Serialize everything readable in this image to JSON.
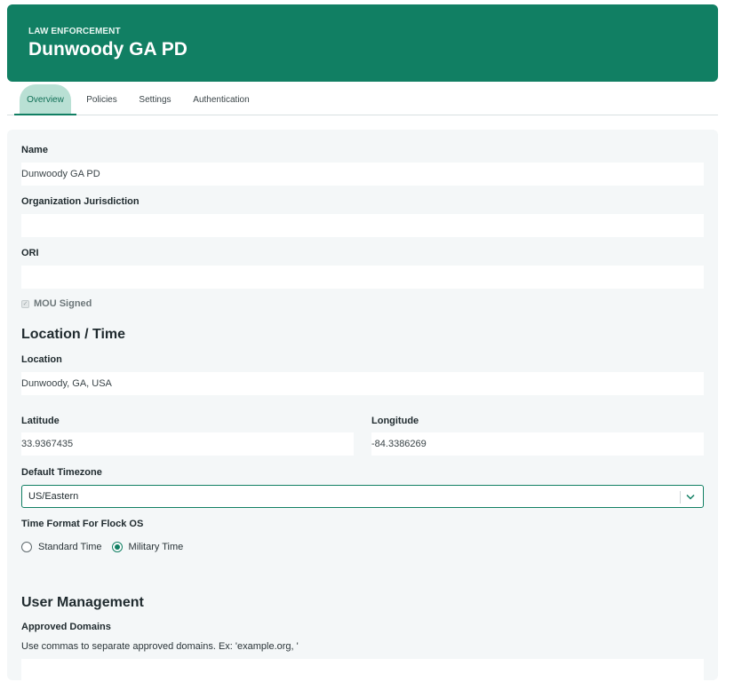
{
  "header": {
    "eyebrow": "LAW ENFORCEMENT",
    "title": "Dunwoody GA PD"
  },
  "tabs": [
    {
      "label": "Overview",
      "active": true
    },
    {
      "label": "Policies",
      "active": false
    },
    {
      "label": "Settings",
      "active": false
    },
    {
      "label": "Authentication",
      "active": false
    }
  ],
  "form": {
    "name_label": "Name",
    "name_value": "Dunwoody GA PD",
    "jurisdiction_label": "Organization Jurisdiction",
    "jurisdiction_value": "",
    "ori_label": "ORI",
    "ori_value": "",
    "mou_label": "MOU Signed",
    "mou_checked": true
  },
  "location_time": {
    "section_title": "Location / Time",
    "location_label": "Location",
    "location_value": "Dunwoody, GA, USA",
    "latitude_label": "Latitude",
    "latitude_value": "33.9367435",
    "longitude_label": "Longitude",
    "longitude_value": "-84.3386269",
    "timezone_label": "Default Timezone",
    "timezone_value": "US/Eastern",
    "time_format_label": "Time Format For Flock OS",
    "time_format_options": [
      {
        "label": "Standard Time",
        "selected": false
      },
      {
        "label": "Military Time",
        "selected": true
      }
    ]
  },
  "user_management": {
    "section_title": "User Management",
    "approved_domains_label": "Approved Domains",
    "approved_domains_hint": "Use commas to separate approved domains. Ex: 'example.org, '"
  },
  "colors": {
    "brand": "#117f63",
    "tab_active_bg": "#b9e0d4",
    "panel_bg": "#f4f7f8"
  }
}
